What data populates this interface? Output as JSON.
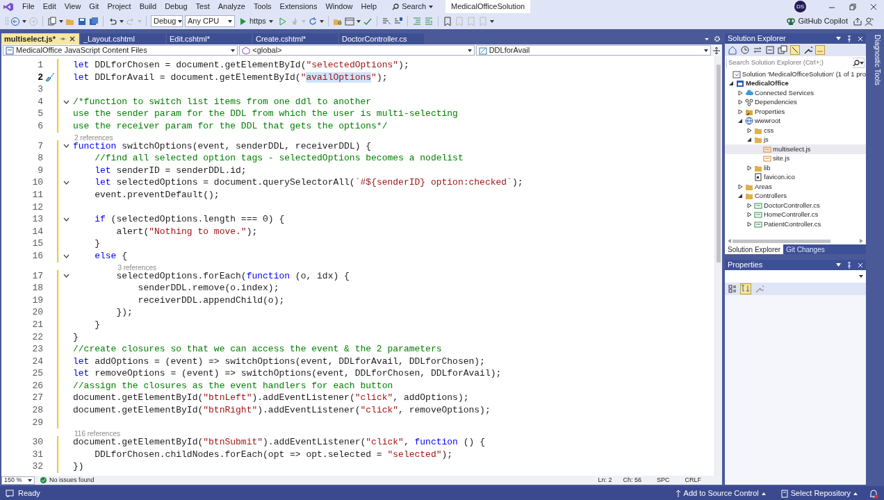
{
  "window": {
    "solution_name": "MedicalOfficeSolution",
    "user_initials": "DS",
    "copilot": "GitHub Copilot"
  },
  "menu": [
    "File",
    "Edit",
    "View",
    "Git",
    "Project",
    "Build",
    "Debug",
    "Test",
    "Analyze",
    "Tools",
    "Extensions",
    "Window",
    "Help"
  ],
  "search": {
    "label": "Search"
  },
  "toolbar": {
    "configuration": "Debug",
    "platform": "Any CPU",
    "run_target": "https"
  },
  "tabs": [
    {
      "label": "multiselect.js*",
      "selected": true
    },
    {
      "label": "_Layout.cshtml",
      "selected": false
    },
    {
      "label": "Edit.cshtml*",
      "selected": false
    },
    {
      "label": "Create.cshtml*",
      "selected": false
    },
    {
      "label": "DoctorController.cs",
      "selected": false
    }
  ],
  "nav_bar": {
    "project": "MedicalOffice JavaScript Content Files",
    "scope": "<global>",
    "member": "DDLforAvail"
  },
  "code": {
    "lines": [
      {
        "number": "1",
        "current": false,
        "fold": false,
        "tokens": [
          {
            "kind": "kw",
            "text": "let"
          },
          {
            "kind": "plain",
            "text": " DDLforChosen = document.getElementById("
          },
          {
            "kind": "str",
            "text": "\"selectedOptions\""
          },
          {
            "kind": "plain",
            "text": ");"
          }
        ]
      },
      {
        "number": "2",
        "current": true,
        "fold": false,
        "tokens": [
          {
            "kind": "kw",
            "text": "let"
          },
          {
            "kind": "plain",
            "text": " DDLforAvail = document.getElementById("
          },
          {
            "kind": "str",
            "text": "\""
          },
          {
            "kind": "str-highlight",
            "text": "availOptions"
          },
          {
            "kind": "str",
            "text": "\""
          },
          {
            "kind": "plain",
            "text": ");"
          }
        ]
      },
      {
        "number": "3",
        "current": false,
        "fold": false
      },
      {
        "number": "4",
        "current": false,
        "fold": true,
        "tokens": [
          {
            "kind": "comment",
            "text": "/*function to switch list items from one ddl to another"
          }
        ]
      },
      {
        "number": "5",
        "current": false,
        "fold": false,
        "tokens": [
          {
            "kind": "comment",
            "text": "use the sender param for the DDL from which the user is multi-selecting"
          }
        ]
      },
      {
        "number": "6",
        "current": false,
        "fold": false,
        "tokens": [
          {
            "kind": "comment",
            "text": "use the receiver param for the DDL that gets the options*/"
          }
        ]
      },
      {
        "number": "7",
        "current": false,
        "fold": true,
        "lens": "2 references",
        "tokens": [
          {
            "kind": "kw",
            "text": "function"
          },
          {
            "kind": "plain",
            "text": " switchOptions(event, senderDDL, receiverDDL) {"
          }
        ]
      },
      {
        "number": "8",
        "current": false,
        "fold": false,
        "tokens": [
          {
            "kind": "comment",
            "text": "    //find all selected option tags - selectedOptions becomes a nodelist"
          }
        ]
      },
      {
        "number": "9",
        "current": false,
        "fold": false,
        "tokens": [
          {
            "kind": "kw",
            "text": "    let"
          },
          {
            "kind": "plain",
            "text": " senderID = senderDDL.id;"
          }
        ]
      },
      {
        "number": "10",
        "current": false,
        "fold": true,
        "tokens": [
          {
            "kind": "kw",
            "text": "    let"
          },
          {
            "kind": "plain",
            "text": " selectedOptions = document.querySelectorAll("
          },
          {
            "kind": "str",
            "text": "`#${senderID} option:checked`"
          },
          {
            "kind": "plain",
            "text": ");"
          }
        ]
      },
      {
        "number": "11",
        "current": false,
        "fold": false,
        "tokens": [
          {
            "kind": "plain",
            "text": "    event.preventDefault();"
          }
        ]
      },
      {
        "number": "12",
        "current": false,
        "fold": false
      },
      {
        "number": "13",
        "current": false,
        "fold": true,
        "tokens": [
          {
            "kind": "kw",
            "text": "    if"
          },
          {
            "kind": "plain",
            "text": " (selectedOptions.length === 0) {"
          }
        ]
      },
      {
        "number": "14",
        "current": false,
        "fold": false,
        "tokens": [
          {
            "kind": "plain",
            "text": "        alert("
          },
          {
            "kind": "str",
            "text": "\"Nothing to move.\""
          },
          {
            "kind": "plain",
            "text": ");"
          }
        ]
      },
      {
        "number": "15",
        "current": false,
        "fold": false,
        "tokens": [
          {
            "kind": "plain",
            "text": "    }"
          }
        ]
      },
      {
        "number": "16",
        "current": false,
        "fold": true,
        "tokens": [
          {
            "kind": "kw",
            "text": "    else"
          },
          {
            "kind": "plain",
            "text": " {"
          }
        ]
      },
      {
        "number": "17",
        "current": false,
        "fold": true,
        "lens": "3 references",
        "tokens": [
          {
            "kind": "plain",
            "text": "        selectedOptions.forEach("
          },
          {
            "kind": "kw",
            "text": "function"
          },
          {
            "kind": "plain",
            "text": " (o, idx) {"
          }
        ]
      },
      {
        "number": "18",
        "current": false,
        "fold": false,
        "tokens": [
          {
            "kind": "plain",
            "text": "            senderDDL.remove(o.index);"
          }
        ]
      },
      {
        "number": "19",
        "current": false,
        "fold": false,
        "tokens": [
          {
            "kind": "plain",
            "text": "            receiverDDL.appendChild(o);"
          }
        ]
      },
      {
        "number": "20",
        "current": false,
        "fold": false,
        "tokens": [
          {
            "kind": "plain",
            "text": "        });"
          }
        ]
      },
      {
        "number": "21",
        "current": false,
        "fold": false,
        "tokens": [
          {
            "kind": "plain",
            "text": "    }"
          }
        ]
      },
      {
        "number": "22",
        "current": false,
        "fold": false,
        "tokens": [
          {
            "kind": "plain",
            "text": "}"
          }
        ]
      },
      {
        "number": "23",
        "current": false,
        "fold": false,
        "tokens": [
          {
            "kind": "comment",
            "text": "//create closures so that we can access the event & the 2 parameters"
          }
        ]
      },
      {
        "number": "24",
        "current": false,
        "fold": false,
        "tokens": [
          {
            "kind": "kw",
            "text": "let"
          },
          {
            "kind": "plain",
            "text": " addOptions = (event) => switchOptions(event, DDLforAvail, DDLforChosen);"
          }
        ]
      },
      {
        "number": "25",
        "current": false,
        "fold": false,
        "tokens": [
          {
            "kind": "kw",
            "text": "let"
          },
          {
            "kind": "plain",
            "text": " removeOptions = (event) => switchOptions(event, DDLforChosen, DDLforAvail);"
          }
        ]
      },
      {
        "number": "26",
        "current": false,
        "fold": false,
        "tokens": [
          {
            "kind": "comment",
            "text": "//assign the closures as the event handlers for each button"
          }
        ]
      },
      {
        "number": "27",
        "current": false,
        "fold": false,
        "tokens": [
          {
            "kind": "plain",
            "text": "document.getElementById("
          },
          {
            "kind": "str",
            "text": "\"btnLeft\""
          },
          {
            "kind": "plain",
            "text": ").addEventListener("
          },
          {
            "kind": "str",
            "text": "\"click\""
          },
          {
            "kind": "plain",
            "text": ", addOptions);"
          }
        ]
      },
      {
        "number": "28",
        "current": false,
        "fold": false,
        "tokens": [
          {
            "kind": "plain",
            "text": "document.getElementById("
          },
          {
            "kind": "str",
            "text": "\"btnRight\""
          },
          {
            "kind": "plain",
            "text": ").addEventListener("
          },
          {
            "kind": "str",
            "text": "\"click\""
          },
          {
            "kind": "plain",
            "text": ", removeOptions);"
          }
        ]
      },
      {
        "number": "29",
        "current": false,
        "fold": false
      },
      {
        "number": "30",
        "current": false,
        "fold": false,
        "lens": "116 references",
        "tokens": [
          {
            "kind": "plain",
            "text": "document.getElementById("
          },
          {
            "kind": "str",
            "text": "\"btnSubmit\""
          },
          {
            "kind": "plain",
            "text": ").addEventListener("
          },
          {
            "kind": "str",
            "text": "\"click\""
          },
          {
            "kind": "plain",
            "text": ", "
          },
          {
            "kind": "kw",
            "text": "function"
          },
          {
            "kind": "plain",
            "text": " () {"
          }
        ]
      },
      {
        "number": "31",
        "current": false,
        "fold": false,
        "tokens": [
          {
            "kind": "plain",
            "text": "    DDLforChosen.childNodes.forEach(opt => opt.selected = "
          },
          {
            "kind": "str",
            "text": "\"selected\""
          },
          {
            "kind": "plain",
            "text": ");"
          }
        ]
      },
      {
        "number": "32",
        "current": false,
        "fold": false,
        "tokens": [
          {
            "kind": "plain",
            "text": "})"
          }
        ]
      }
    ]
  },
  "editor_status": {
    "zoom": "150 %",
    "issues": "No issues found",
    "line": "Ln: 2",
    "column": "Ch: 56",
    "whitespace": "SPC",
    "line_ending": "CRLF"
  },
  "solution_explorer": {
    "title": "Solution Explorer",
    "search": {
      "placeholder": "Search Solution Explorer (Ctrl+;)"
    },
    "tree": [
      {
        "label": "Solution 'MedicalOfficeSolution' (1 of 1 pro",
        "kind": "solution",
        "expandable": false,
        "selected": false
      },
      {
        "label": "MedicalOffice",
        "kind": "project",
        "expandable": true,
        "expanded": true,
        "selected": false,
        "children": [
          {
            "label": "Connected Services",
            "kind": "cloud",
            "expandable": true,
            "expanded": false,
            "selected": false
          },
          {
            "label": "Dependencies",
            "kind": "deps",
            "expandable": true,
            "expanded": false,
            "selected": false
          },
          {
            "label": "Properties",
            "kind": "props",
            "expandable": true,
            "expanded": false,
            "selected": false
          },
          {
            "label": "wwwroot",
            "kind": "globe",
            "expandable": true,
            "expanded": true,
            "selected": false,
            "children": [
              {
                "label": "css",
                "kind": "folder",
                "expandable": true,
                "expanded": false,
                "selected": false
              },
              {
                "label": "js",
                "kind": "folder",
                "expandable": true,
                "expanded": true,
                "selected": false,
                "children": [
                  {
                    "label": "multiselect.js",
                    "kind": "js",
                    "expandable": false,
                    "selected": true
                  },
                  {
                    "label": "site.js",
                    "kind": "js",
                    "expandable": false,
                    "selected": false
                  }
                ]
              },
              {
                "label": "lib",
                "kind": "folder",
                "expandable": true,
                "expanded": false,
                "selected": false
              },
              {
                "label": "favicon.ico",
                "kind": "file",
                "expandable": false,
                "selected": false
              }
            ]
          },
          {
            "label": "Areas",
            "kind": "folder",
            "expandable": true,
            "expanded": false,
            "selected": false
          },
          {
            "label": "Controllers",
            "kind": "folder",
            "expandable": true,
            "expanded": true,
            "selected": false,
            "children": [
              {
                "label": "DoctorController.cs",
                "kind": "cs",
                "expandable": true,
                "expanded": false,
                "selected": false
              },
              {
                "label": "HomeController.cs",
                "kind": "cs",
                "expandable": true,
                "expanded": false,
                "selected": false
              },
              {
                "label": "PatientController.cs",
                "kind": "cs",
                "expandable": true,
                "expanded": false,
                "selected": false
              }
            ]
          }
        ]
      }
    ],
    "tabs": [
      {
        "label": "Solution Explorer",
        "selected": true
      },
      {
        "label": "Git Changes",
        "selected": false
      }
    ]
  },
  "properties": {
    "title": "Properties"
  },
  "side_strip": {
    "label": "Diagnostic Tools"
  },
  "status_bar": {
    "message": "Ready",
    "source_control": "Add to Source Control",
    "repository": "Select Repository"
  }
}
